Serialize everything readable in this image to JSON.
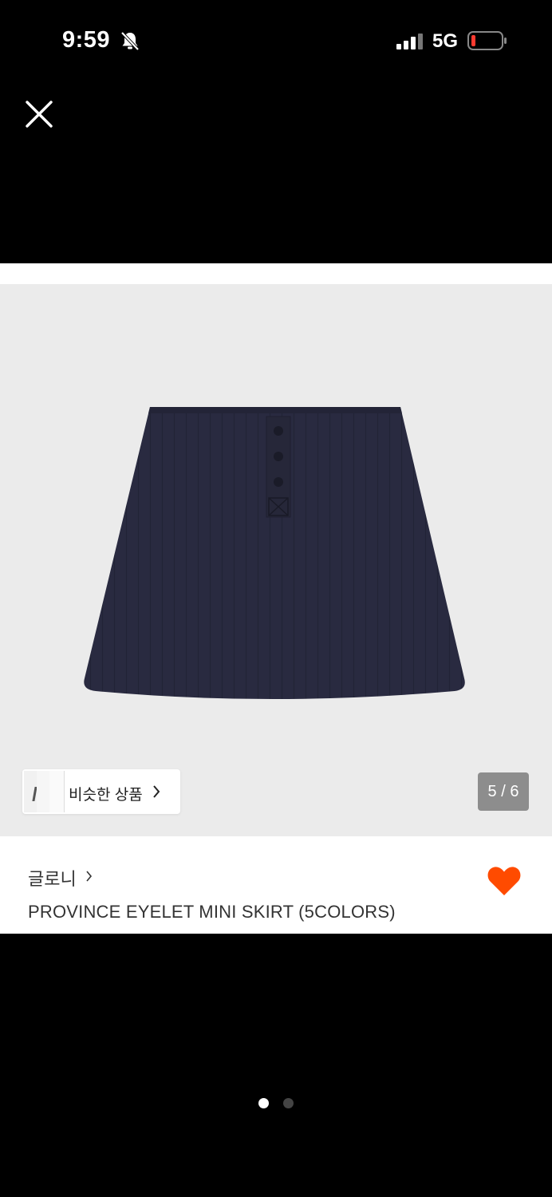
{
  "status_bar": {
    "time": "9:59",
    "network": "5G",
    "icons": [
      "silent-bell-icon",
      "signal-icon",
      "battery-icon"
    ]
  },
  "viewer": {
    "close_icon": "close-icon",
    "similar_button_label": "비슷한 상품",
    "page_counter": "5 / 6",
    "pagination": {
      "current": 1,
      "total": 2
    }
  },
  "product": {
    "brand": "글로니",
    "title": "PROVINCE EYELET MINI SKIRT (5COLORS)",
    "favorite_icon": "heart-icon",
    "favorite_color": "#ff4b00"
  },
  "colors": {
    "background": "#000000",
    "image_bg": "#ebebeb",
    "skirt": "#292a40",
    "counter_bg": "#8d8d8d"
  }
}
